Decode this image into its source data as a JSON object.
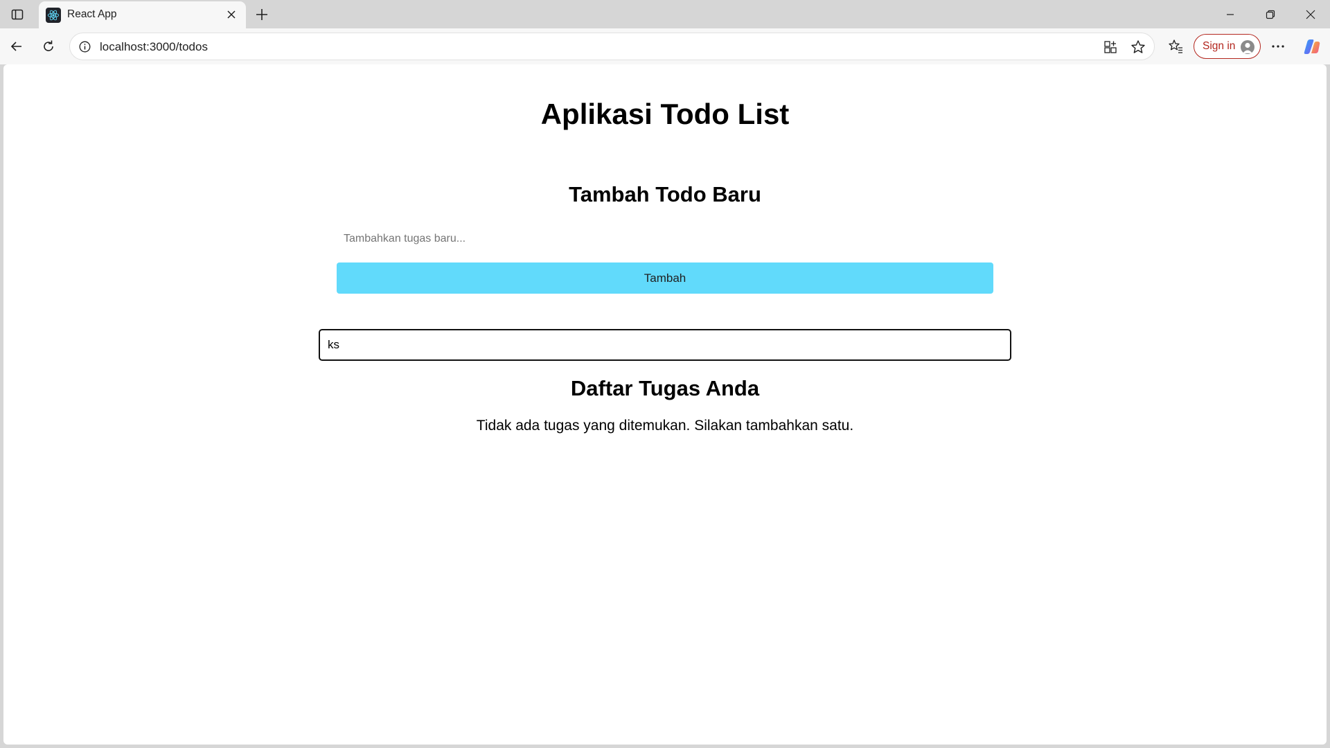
{
  "browser": {
    "tab_title": "React App",
    "url": "localhost:3000/todos",
    "signin_label": "Sign in"
  },
  "page": {
    "app_title": "Aplikasi Todo List",
    "add_section_title": "Tambah Todo Baru",
    "todo_input": {
      "placeholder": "Tambahkan tugas baru...",
      "value": ""
    },
    "add_button_label": "Tambah",
    "search_input": {
      "value": "ks"
    },
    "list_title": "Daftar Tugas Anda",
    "empty_message": "Tidak ada tugas yang ditemukan. Silakan tambahkan satu."
  },
  "colors": {
    "add_button": "#61dafb",
    "signin_accent": "#b3261e"
  },
  "icons": [
    "tab-actions-icon",
    "react-logo-icon",
    "close-icon",
    "plus-icon",
    "minimize-icon",
    "restore-icon",
    "window-close-icon",
    "back-arrow-icon",
    "refresh-icon",
    "info-icon",
    "app-grid-icon",
    "star-icon",
    "favorites-icon",
    "profile-icon",
    "more-icon",
    "copilot-icon"
  ]
}
